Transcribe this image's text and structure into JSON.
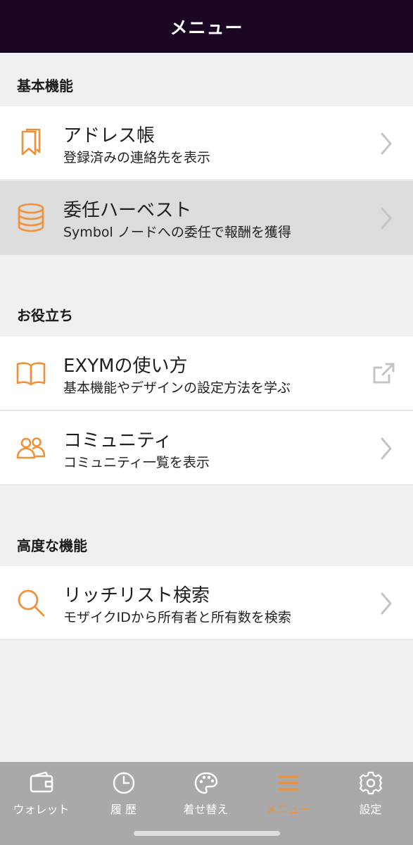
{
  "header": {
    "title": "メニュー"
  },
  "accent_color": "#f0913a",
  "sections": [
    {
      "title": "基本機能",
      "items": [
        {
          "icon": "bookmark-icon",
          "title": "アドレス帳",
          "subtitle": "登録済みの連絡先を表示",
          "trailing": "chevron-right-icon",
          "selected": false
        },
        {
          "icon": "database-icon",
          "title": "委任ハーベスト",
          "subtitle": "Symbol ノードへの委任で報酬を獲得",
          "trailing": "chevron-right-icon",
          "selected": true
        }
      ]
    },
    {
      "title": "お役立ち",
      "items": [
        {
          "icon": "book-open-icon",
          "title": "EXYMの使い方",
          "subtitle": "基本機能やデザインの設定方法を学ぶ",
          "trailing": "external-link-icon",
          "selected": false
        },
        {
          "icon": "users-icon",
          "title": "コミュニティ",
          "subtitle": "コミュニティ一覧を表示",
          "trailing": "chevron-right-icon",
          "selected": false
        }
      ]
    },
    {
      "title": "高度な機能",
      "items": [
        {
          "icon": "search-icon",
          "title": "リッチリスト検索",
          "subtitle": "モザイクIDから所有者と所有数を検索",
          "trailing": "chevron-right-icon",
          "selected": false
        }
      ]
    }
  ],
  "tabs": [
    {
      "icon": "wallet-icon",
      "label": "ウォレット",
      "active": false
    },
    {
      "icon": "clock-icon",
      "label": "履 歴",
      "active": false
    },
    {
      "icon": "palette-icon",
      "label": "着せ替え",
      "active": false
    },
    {
      "icon": "menu-icon",
      "label": "メニュー",
      "active": true
    },
    {
      "icon": "gear-icon",
      "label": "設定",
      "active": false
    }
  ]
}
